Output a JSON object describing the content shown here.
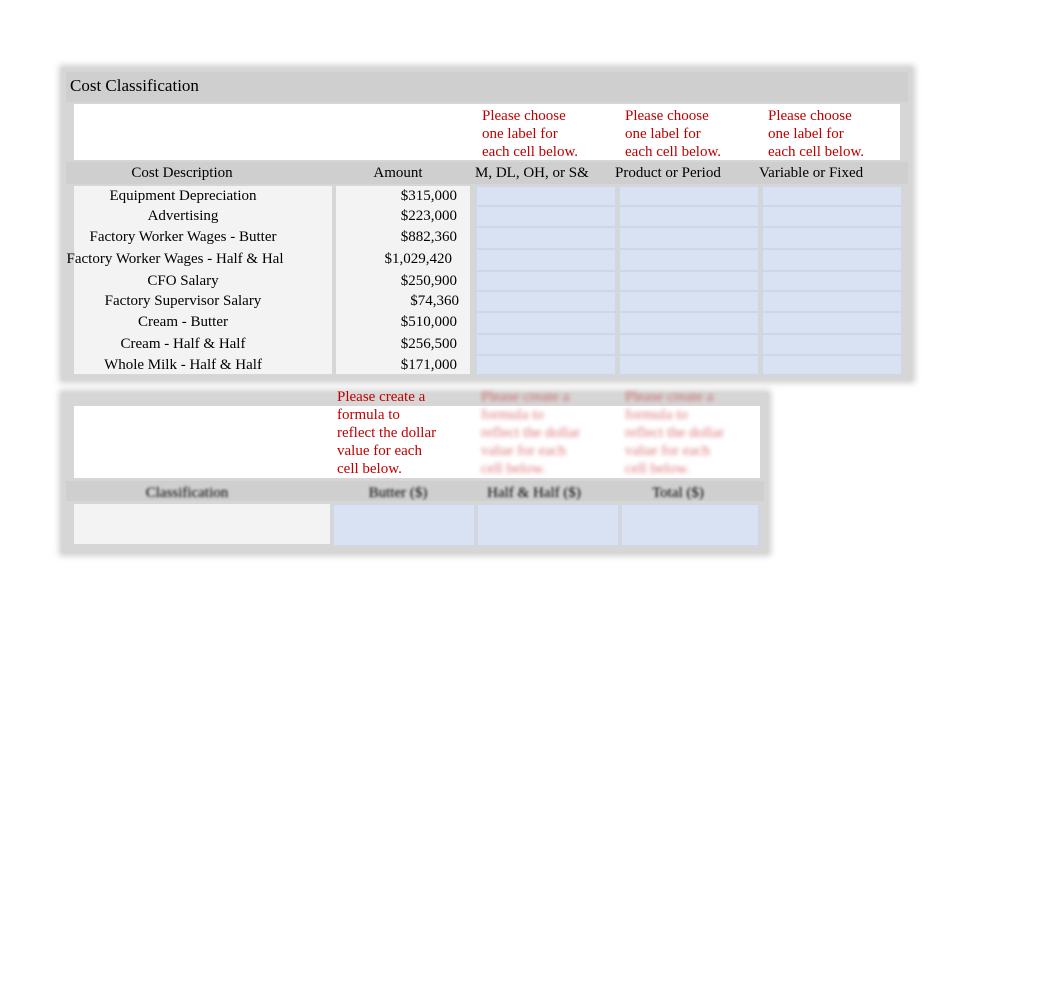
{
  "title": "Cost Classification",
  "instructions": {
    "choose_label": [
      "Please choose",
      "one label for",
      "each cell below."
    ],
    "create_formula": [
      "Please create a",
      "formula to",
      "reflect the dollar",
      "value for each",
      "cell below."
    ]
  },
  "table1": {
    "headers": [
      "Cost Description",
      "Amount",
      "M, DL, OH, or S&",
      "Product or Period",
      "Variable or Fixed"
    ],
    "rows": [
      {
        "description": "Equipment Depreciation",
        "amount": "$315,000"
      },
      {
        "description": "Advertising",
        "amount": "$223,000"
      },
      {
        "description": "Factory Worker Wages - Butter",
        "amount": "$882,360"
      },
      {
        "description": "Factory Worker Wages - Half & Hal",
        "amount": "$1,029,420"
      },
      {
        "description": "CFO Salary",
        "amount": "$250,900"
      },
      {
        "description": "Factory Supervisor Salary",
        "amount": "$74,360"
      },
      {
        "description": "Cream - Butter",
        "amount": "$510,000"
      },
      {
        "description": "Cream - Half & Half",
        "amount": "$256,500"
      },
      {
        "description": "Whole Milk - Half & Half",
        "amount": "$171,000"
      }
    ]
  },
  "table2": {
    "headers": [
      "Classification",
      "Butter ($)",
      "Half & Half ($)",
      "Total ($)"
    ]
  },
  "colors": {
    "instruction_red": "#c00000",
    "input_blue": "#d9e2f2",
    "header_gray": "#cfcfcf"
  }
}
